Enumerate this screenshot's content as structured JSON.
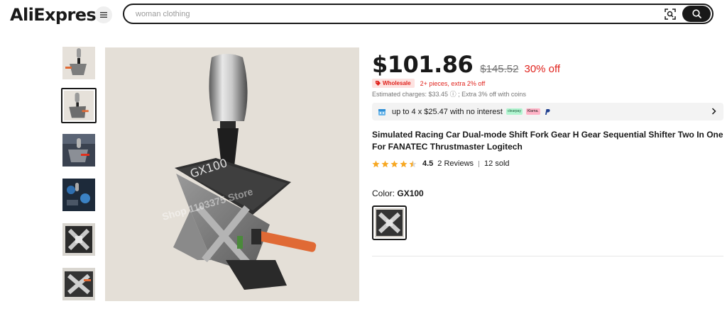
{
  "header": {
    "logo": "AliExpress",
    "search_placeholder": "woman clothing",
    "menu_icon": "hamburger-menu-icon",
    "camera_icon": "image-search-icon",
    "search_icon": "search-icon"
  },
  "gallery": {
    "thumbnails": [
      {
        "name": "thumb-1",
        "selected": false
      },
      {
        "name": "thumb-2",
        "selected": true
      },
      {
        "name": "thumb-3",
        "selected": false
      },
      {
        "name": "thumb-4",
        "selected": false
      },
      {
        "name": "thumb-5",
        "selected": false
      },
      {
        "name": "thumb-6",
        "selected": false
      }
    ],
    "watermark": "Shop 1103375 Store"
  },
  "product": {
    "price": "$101.86",
    "old_price": "$145.52",
    "discount": "30% off",
    "wholesale_badge": "Wholesale",
    "wholesale_text": "2+ pieces, extra 2% off",
    "charges": "Estimated charges: $33.45 ⓘ ; Extra 3% off with coins",
    "installment_text": "up to 4 x $25.47 with no interest",
    "title": "Simulated Racing Car Dual-mode Shift Fork Gear H Gear Sequential Shifter Two In One For FANATEC Thrustmaster Logitech",
    "rating": "4.5",
    "reviews": "2 Reviews",
    "sold": "12 sold",
    "color_label": "Color:",
    "color_value": "GX100",
    "stars_filled": 4.5
  },
  "colors": {
    "accent": "#e0231d",
    "text": "#191919",
    "star": "#f7a823",
    "muted": "#757575"
  }
}
